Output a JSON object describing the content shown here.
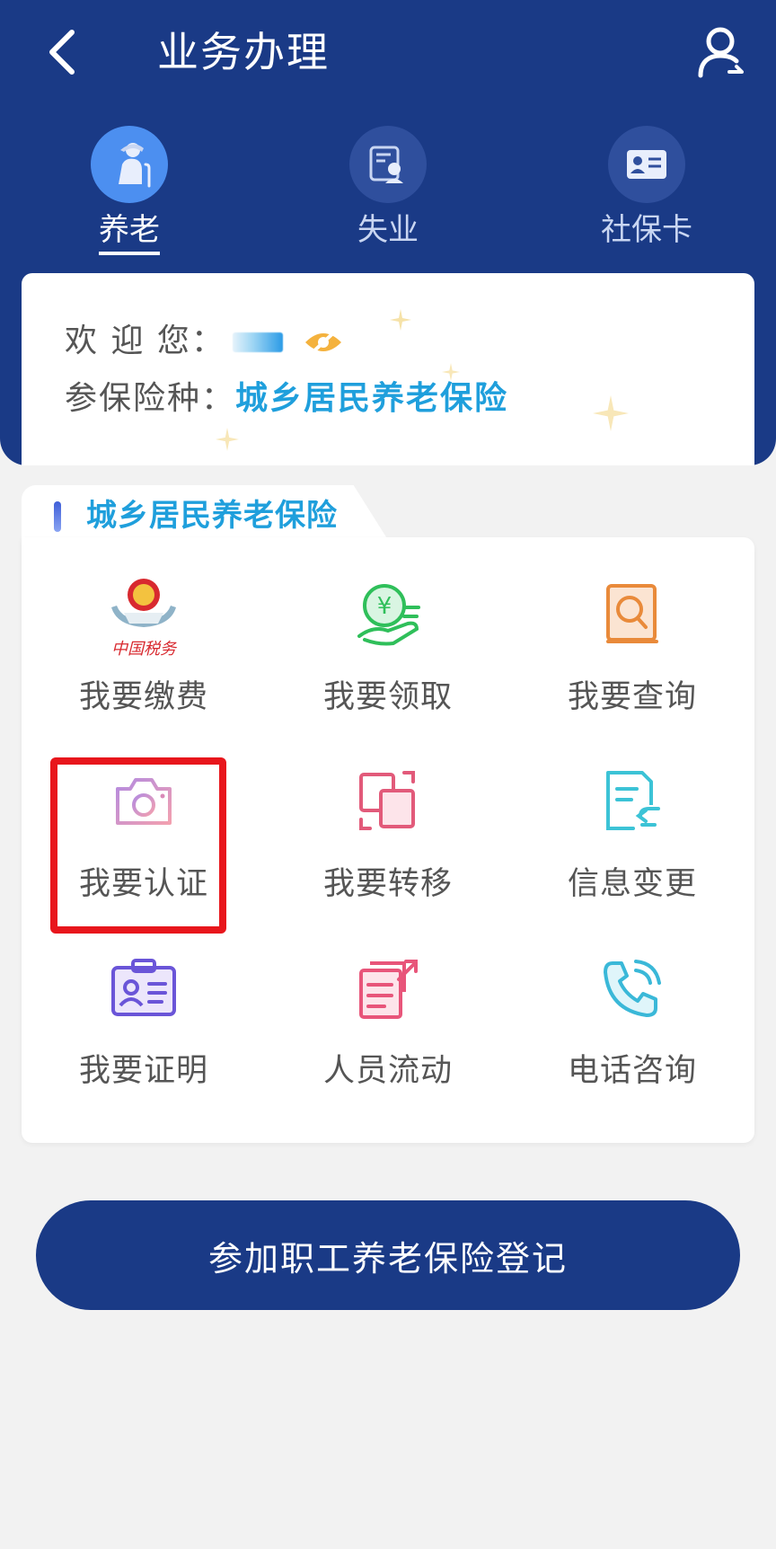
{
  "header": {
    "title": "业务办理"
  },
  "tabs": [
    {
      "label": "养老",
      "icon": "elderly-icon",
      "active": true
    },
    {
      "label": "失业",
      "icon": "id-search-icon",
      "active": false
    },
    {
      "label": "社保卡",
      "icon": "id-card-icon",
      "active": false
    }
  ],
  "welcome": {
    "greeting_label": "欢 迎 您：",
    "insurance_label": "参保险种：",
    "insurance_value": "城乡居民养老保险"
  },
  "panel": {
    "title": "城乡居民养老保险",
    "items": [
      {
        "label": "我要缴费",
        "icon": "tax-emblem-icon"
      },
      {
        "label": "我要领取",
        "icon": "receive-money-icon",
        "color": "#2fbf5a"
      },
      {
        "label": "我要查询",
        "icon": "search-book-icon",
        "color": "#e98a3a"
      },
      {
        "label": "我要认证",
        "icon": "camera-icon",
        "color": "#d98ab8"
      },
      {
        "label": "我要转移",
        "icon": "transfer-icon",
        "color": "#e25a7a"
      },
      {
        "label": "信息变更",
        "icon": "document-change-icon",
        "color": "#3cc3d6"
      },
      {
        "label": "我要证明",
        "icon": "badge-icon",
        "color": "#6a55d8"
      },
      {
        "label": "人员流动",
        "icon": "document-export-icon",
        "color": "#e8557a"
      },
      {
        "label": "电话咨询",
        "icon": "phone-icon",
        "color": "#3ab8d8"
      }
    ]
  },
  "cta": {
    "label": "参加职工养老保险登记"
  },
  "colors": {
    "primary": "#1a3a86",
    "accent": "#1f9fdc",
    "highlight": "#e8161c"
  }
}
